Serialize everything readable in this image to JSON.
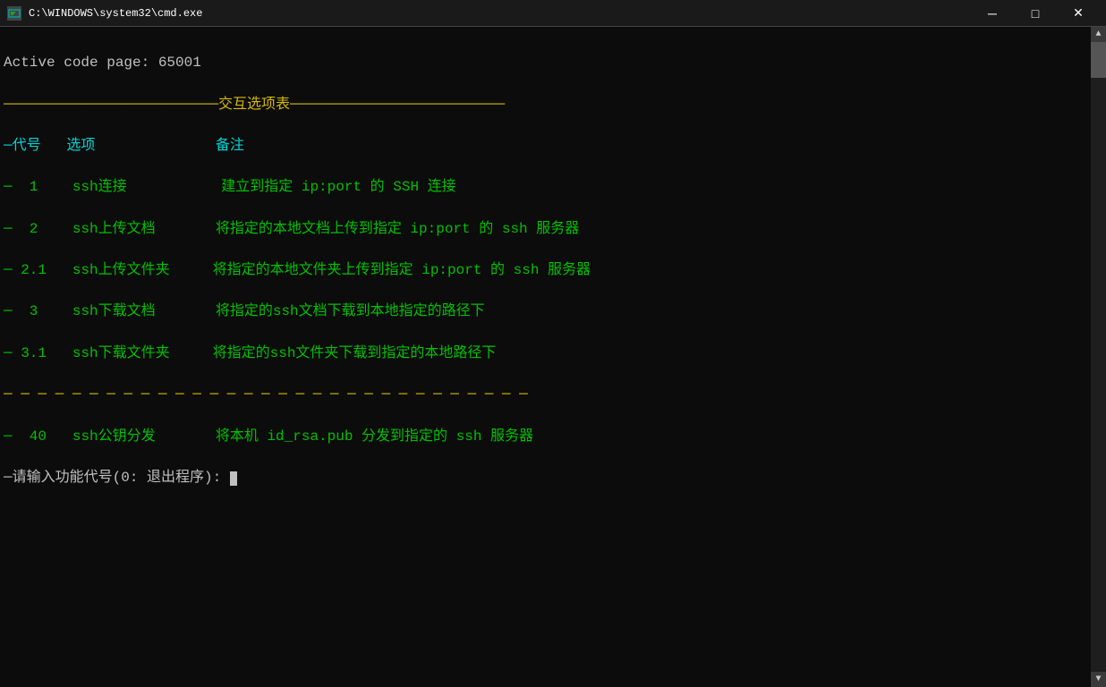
{
  "titlebar": {
    "icon": "■",
    "title": "C:\\WINDOWS\\system32\\cmd.exe",
    "minimize_label": "─",
    "maximize_label": "□",
    "close_label": "✕"
  },
  "terminal": {
    "line1": "Active code page: 65001",
    "separator_top": "─────────────────────────交互选项表─────────────────────────",
    "header": "─代号   选项              备注",
    "row1": "─  1    ssh连接           建立到指定 ip:port 的 SSH 连接",
    "row2": "─  2    ssh上传文档       将指定的本地文档上传到指定 ip:port 的 ssh 服务器",
    "row2_1": "─ 2.1   ssh上传文件夹     将指定的本地文件夹上传到指定 ip:port 的 ssh 服务器",
    "row3": "─  3    ssh下载文档       将指定的ssh文档下载到本地指定的路径下",
    "row3_1": "─ 3.1   ssh下载文件夹     将指定的ssh文件夹下载到指定的本地路径下",
    "separator_mid": "─ ─ ─ ─ ─ ─ ─ ─ ─ ─ ─ ─ ─ ─ ─ ─ ─ ─ ─ ─ ─ ─ ─ ─ ─ ─ ─ ─ ─ ─ ─",
    "row40": "─  40   ssh公钥分发       将本机 id_rsa.pub 分发到指定的 ssh 服务器",
    "prompt": "─请输入功能代号(0: 退出程序): "
  }
}
